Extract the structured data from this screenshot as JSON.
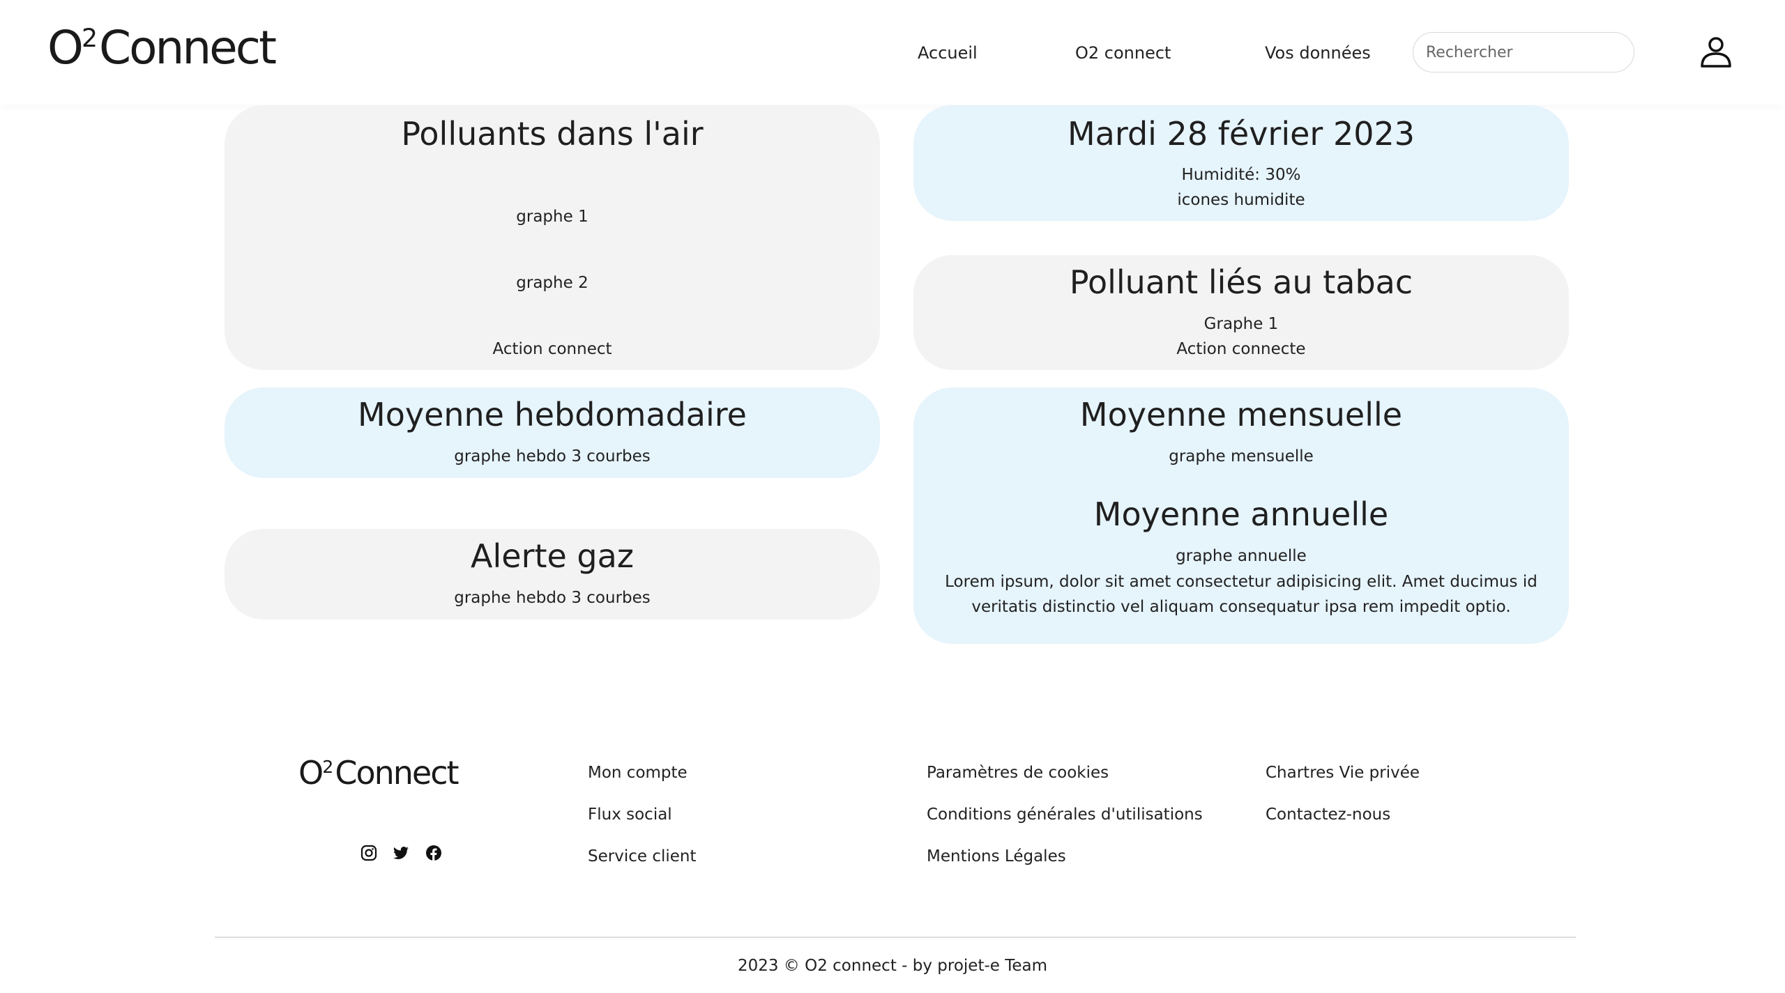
{
  "header": {
    "logo": {
      "prefix": "O",
      "sup": "2",
      "suffix": "Connect"
    },
    "nav": [
      "Accueil",
      "O2 connect",
      "Vos données"
    ],
    "search_placeholder": "Rechercher"
  },
  "cards": {
    "air": {
      "title": "Polluants dans l'air",
      "lines": [
        "graphe 1",
        "graphe 2",
        "Action connect"
      ]
    },
    "date": {
      "title": "Mardi 28 février 2023",
      "lines": [
        "Humidité: 30%",
        "icones humidite"
      ]
    },
    "tabac": {
      "title": "Polluant liés au tabac",
      "lines": [
        "Graphe 1",
        "Action connecte"
      ]
    },
    "hebdo": {
      "title": "Moyenne hebdomadaire",
      "lines": [
        "graphe hebdo 3 courbes"
      ]
    },
    "mensuelle": {
      "title": "Moyenne mensuelle",
      "line": "graphe mensuelle",
      "title2": "Moyenne annuelle",
      "line2": "graphe annuelle",
      "paragraph": "Lorem ipsum, dolor sit amet consectetur adipisicing elit. Amet ducimus id veritatis distinctio vel aliquam consequatur ipsa rem impedit optio."
    },
    "gaz": {
      "title": "Alerte gaz",
      "lines": [
        "graphe hebdo 3 courbes"
      ]
    }
  },
  "footer": {
    "logo": {
      "prefix": "O",
      "sup": "2",
      "suffix": "Connect"
    },
    "social_icons": [
      "instagram-icon",
      "twitter-icon",
      "facebook-icon"
    ],
    "col1": [
      "Mon compte",
      "Flux social",
      "Service client"
    ],
    "col2": [
      "Paramètres de cookies",
      "Conditions générales d'utilisations",
      "Mentions Légales"
    ],
    "col3": [
      "Chartres Vie privée",
      "Contactez-nous"
    ],
    "copyright": "2023 © O2 connect - by projet-e Team"
  },
  "colors": {
    "card_grey": "#f3f3f3",
    "card_blue": "#e6f4fc",
    "text": "#222222"
  }
}
